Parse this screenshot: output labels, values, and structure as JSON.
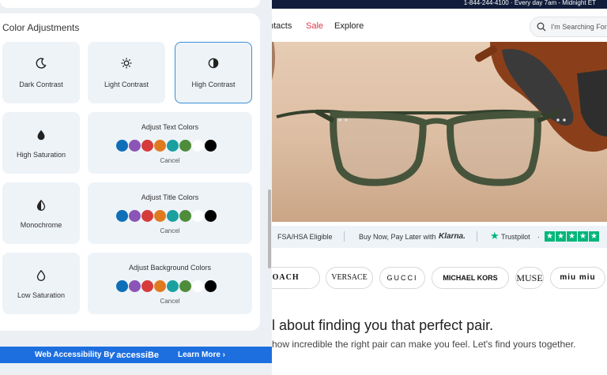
{
  "store": {
    "topbar_text": "1-844-244-4100 · Every day 7am - Midnight ET",
    "nav": {
      "contacts": "ntacts",
      "sale": "Sale",
      "explore": "Explore"
    },
    "search_placeholder": "I'm Searching For...",
    "infobar": {
      "fsa": "FSA/HSA Eligible",
      "bnpl": "Buy Now, Pay Later with",
      "klarna": "Klarna.",
      "trustpilot": "Trustpilot",
      "dot": "·"
    },
    "brands": [
      "COACH",
      "VERSACE",
      "GUCCI",
      "MICHAEL KORS",
      "MUSE",
      "miu miu"
    ],
    "headline": "ll about finding you that perfect pair.",
    "subline": "how incredible the right pair can make you feel. Let's find yours together."
  },
  "panel": {
    "title": "Color Adjustments",
    "contrast_cards": [
      {
        "label": "Dark Contrast",
        "icon": "moon-icon"
      },
      {
        "label": "Light Contrast",
        "icon": "sun-icon"
      },
      {
        "label": "High Contrast",
        "icon": "contrast-icon",
        "selected": true
      }
    ],
    "saturation_cards": [
      {
        "label": "High Saturation",
        "icon": "drop-filled-icon"
      },
      {
        "label": "Monochrome",
        "icon": "drop-half-icon"
      },
      {
        "label": "Low Saturation",
        "icon": "drop-outline-icon"
      }
    ],
    "color_cards": [
      {
        "title": "Adjust Text Colors",
        "cancel": "Cancel"
      },
      {
        "title": "Adjust Title Colors",
        "cancel": "Cancel"
      },
      {
        "title": "Adjust Background Colors",
        "cancel": "Cancel"
      }
    ],
    "swatch_colors": [
      "#0e6fb8",
      "#8a55b6",
      "#d63b3b",
      "#e07a1f",
      "#1ba0a0",
      "#4f8c3a",
      "#ffffff",
      "#000000"
    ]
  },
  "footer": {
    "by": "Web Accessibility By",
    "brand": "✓accessiBe",
    "more": "Learn More ›"
  },
  "colors": {
    "accent": "#1d6fe0",
    "selected_border": "#3b8fd8",
    "card_bg": "#eef3f8",
    "sale": "#e0364b",
    "trustpilot": "#00b67a"
  }
}
